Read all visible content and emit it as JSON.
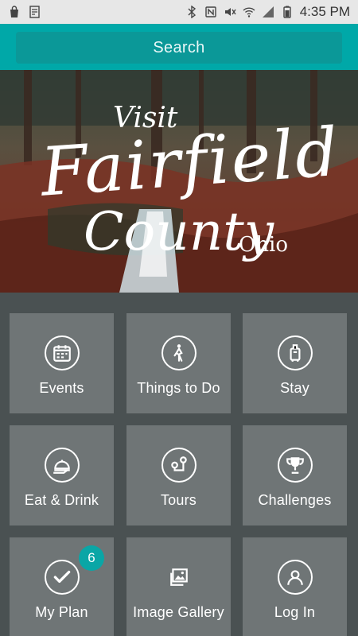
{
  "status_bar": {
    "time": "4:35 PM",
    "left_icons": [
      "shopping-bag-icon",
      "receipt-icon"
    ],
    "right_icons": [
      "bluetooth-icon",
      "nfc-icon",
      "mute-icon",
      "wifi-icon",
      "signal-icon",
      "battery-icon"
    ]
  },
  "search": {
    "label": "Search"
  },
  "hero": {
    "title_line1": "Visit",
    "title_line2": "Fairfield",
    "title_line3": "County",
    "title_line4": "Ohio"
  },
  "tiles": [
    {
      "label": "Events",
      "icon": "calendar-icon"
    },
    {
      "label": "Things to Do",
      "icon": "walking-person-icon"
    },
    {
      "label": "Stay",
      "icon": "luggage-icon"
    },
    {
      "label": "Eat & Drink",
      "icon": "dining-cloche-icon"
    },
    {
      "label": "Tours",
      "icon": "map-route-icon"
    },
    {
      "label": "Challenges",
      "icon": "trophy-icon"
    },
    {
      "label": "My Plan",
      "icon": "checkmark-icon",
      "badge": "6"
    },
    {
      "label": "Image Gallery",
      "icon": "image-gallery-icon"
    },
    {
      "label": "Log In",
      "icon": "user-icon"
    }
  ],
  "colors": {
    "accent": "#00a8a8",
    "tile": "#6f7576",
    "background": "#4a5152"
  }
}
